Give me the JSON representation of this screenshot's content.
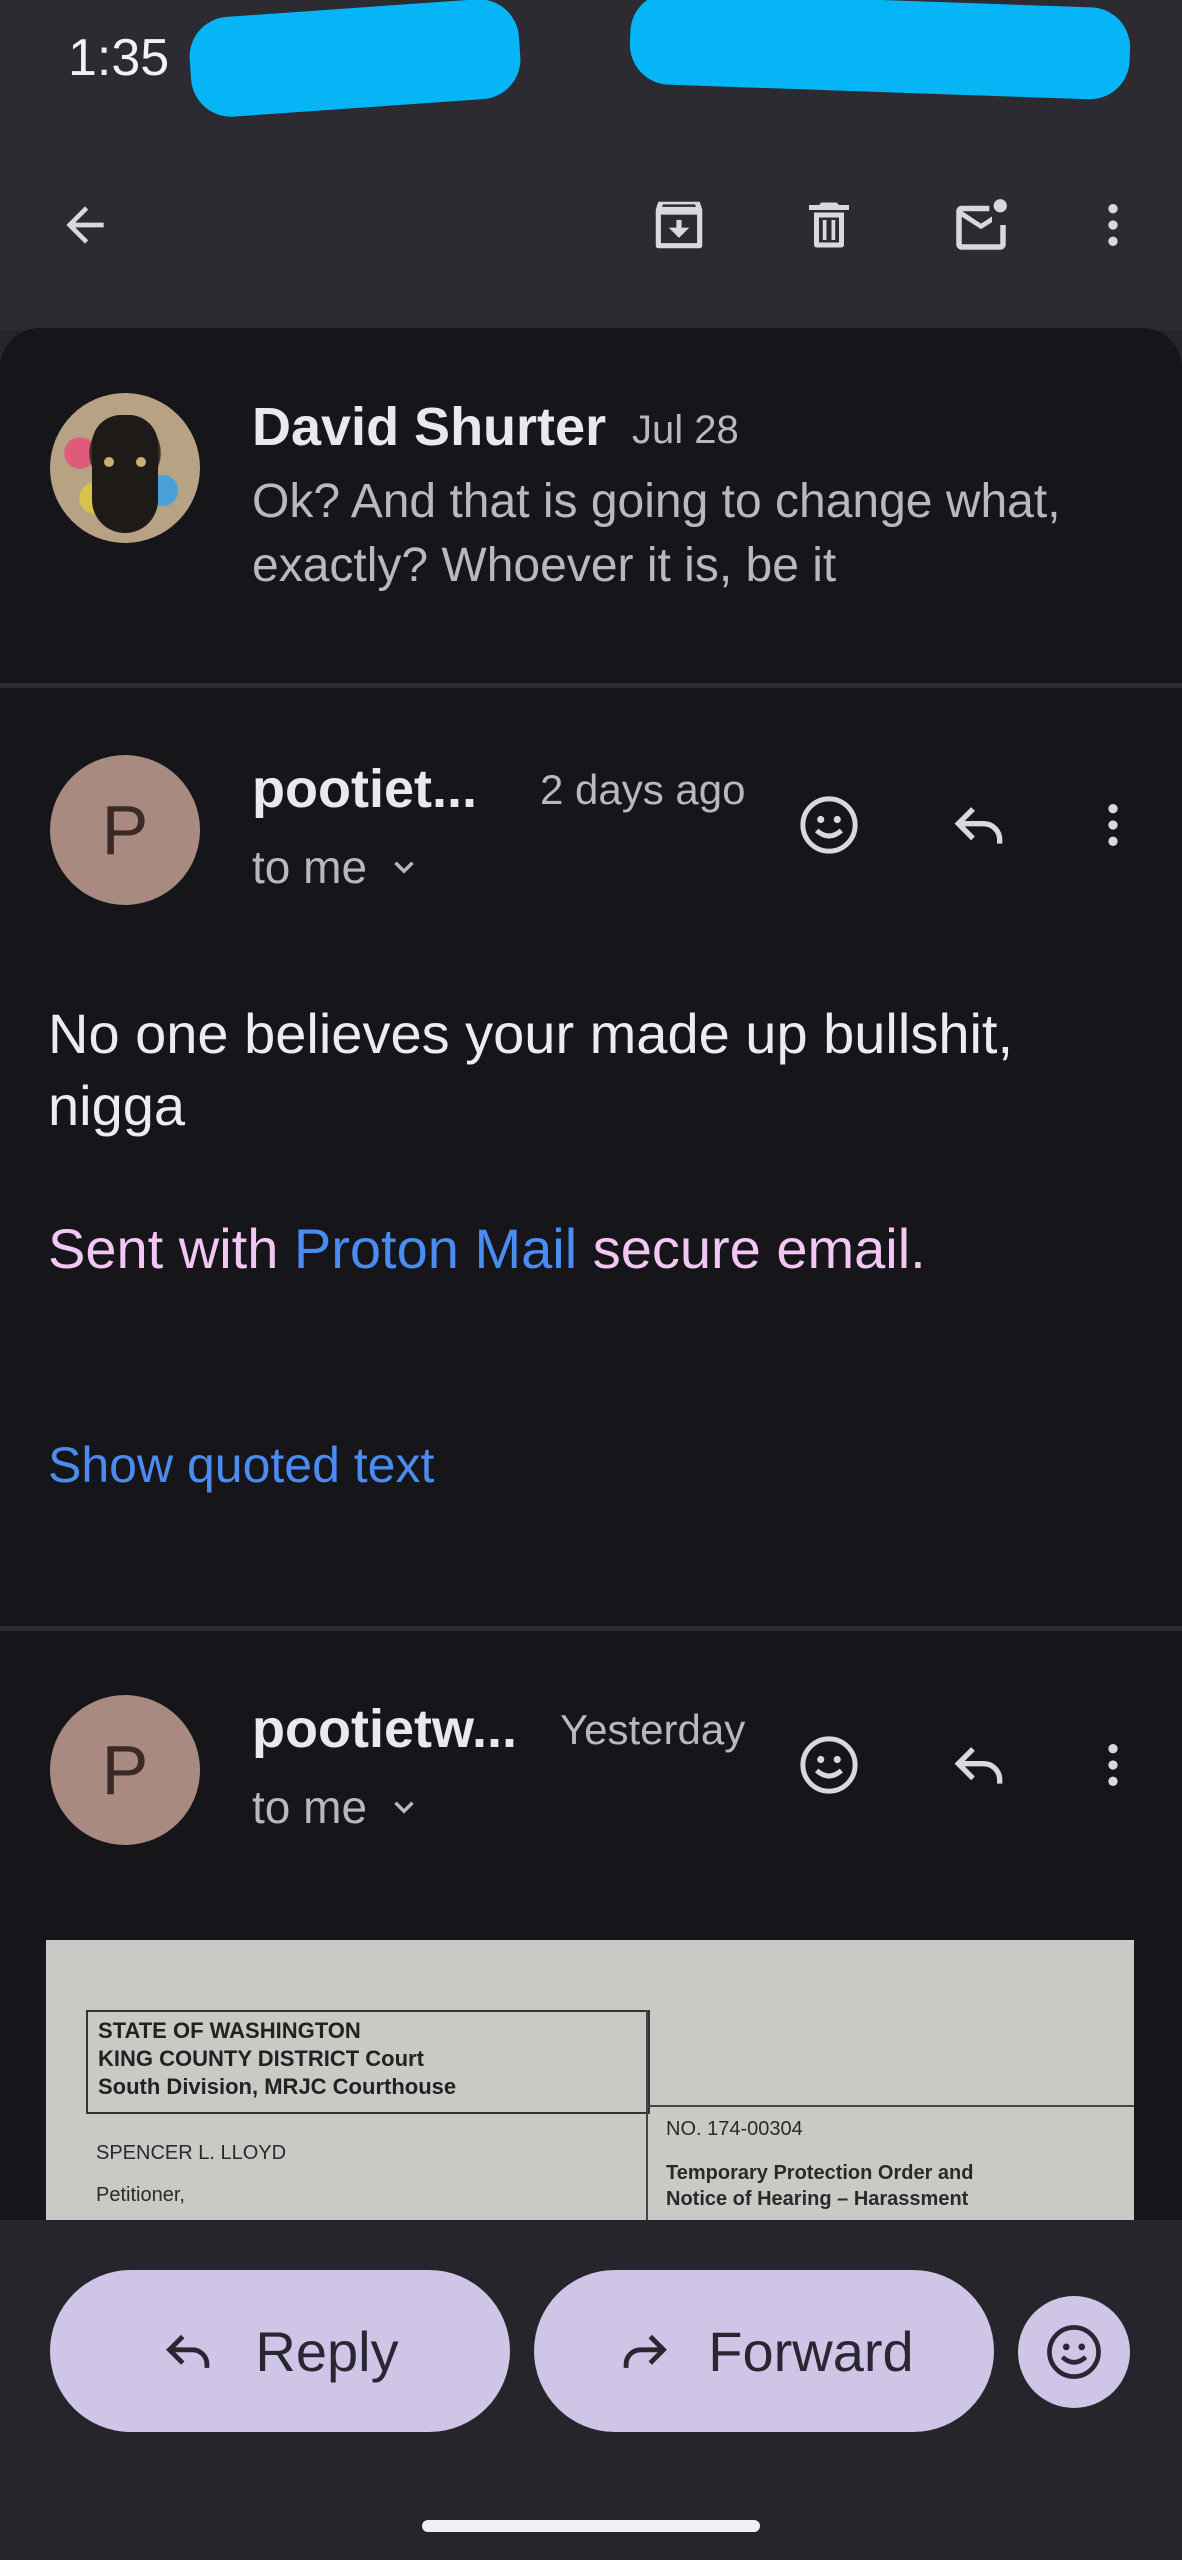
{
  "status": {
    "time": "1:35"
  },
  "toolbar": {
    "back_icon": "arrow-back-icon",
    "archive_icon": "archive-icon",
    "delete_icon": "trash-icon",
    "mark_unread_icon": "mail-unread-icon",
    "more_icon": "more-vert-icon"
  },
  "thread": {
    "collapsed": {
      "sender": "David Shurter",
      "date": "Jul 28",
      "snippet": "Ok? And that is going to change what, exactly? Whoever it is, be it"
    },
    "messages": [
      {
        "avatar_letter": "P",
        "sender": "pootiet...",
        "time": "2 days ago",
        "recipient": "to me",
        "body": "No one believes your made up bullshit, nigga",
        "signature_prefix": "Sent with ",
        "signature_link": "Proton Mail",
        "signature_suffix": " secure email.",
        "quoted_link": "Show quoted text"
      },
      {
        "avatar_letter": "P",
        "sender": "pootietw...",
        "time": "Yesterday",
        "recipient": "to me"
      }
    ],
    "attachment": {
      "line1": "STATE OF WASHINGTON",
      "line2": "KING COUNTY DISTRICT Court",
      "line3": "South Division, MRJC Courthouse",
      "petitioner_name": "SPENCER L. LLOYD",
      "petitioner_label": "Petitioner,",
      "case_no": "NO. 174-00304",
      "order_title_1": "Temporary Protection Order and",
      "order_title_2": "Notice of Hearing – Harassment"
    }
  },
  "actions": {
    "reply_label": "Reply",
    "forward_label": "Forward"
  },
  "colors": {
    "background": "#15151a",
    "chrome": "#2b2b31",
    "pill": "#cfc5e7",
    "link": "#4b8cf2",
    "signature": "#f3c7f3",
    "redaction": "#06b5f6"
  }
}
